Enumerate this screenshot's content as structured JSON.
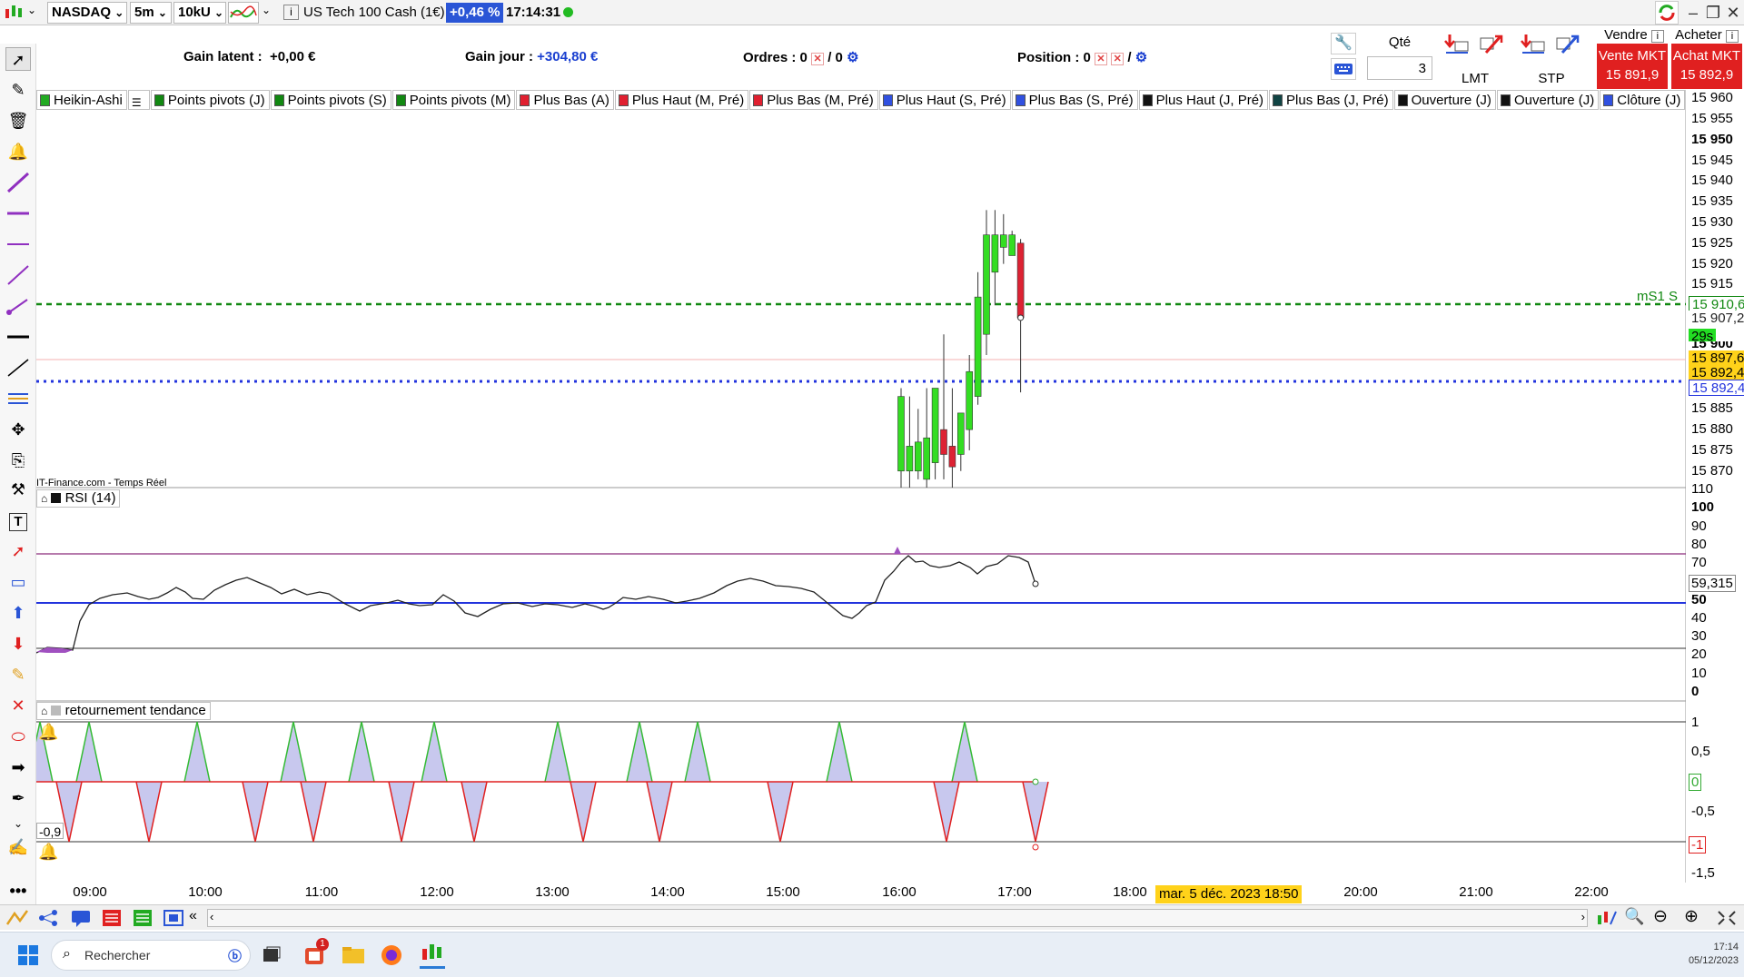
{
  "toolbar": {
    "market": "NASDAQ",
    "timeframe": "5m",
    "units": "10kU",
    "instrument": "US Tech 100 Cash (1€)",
    "change_pct": "+0,46 %",
    "time": "17:14:31"
  },
  "info": {
    "gain_latent_label": "Gain latent :",
    "gain_latent_value": "+0,00 €",
    "gain_jour_label": "Gain jour :",
    "gain_jour_value": "+304,80 €",
    "ordres_label": "Ordres :",
    "ordres_value": "0",
    "ordres_second": "/ 0",
    "position_label": "Position :",
    "position_value": "0",
    "position_sep": "/"
  },
  "order_panel": {
    "qty_label": "Qté",
    "qty_value": "3",
    "lmt_label": "LMT",
    "stp_label": "STP",
    "vendre_label": "Vendre",
    "acheter_label": "Acheter",
    "vente_mkt": "Vente MKT",
    "vente_price": "15 891,9",
    "achat_mkt": "Achat MKT",
    "achat_price": "15 892,9"
  },
  "legend": [
    {
      "label": "Heikin-Ashi",
      "color": "#22aa22"
    },
    {
      "label": "",
      "color": "#ffffff"
    },
    {
      "label": "Points pivots (J)",
      "color": "#118811"
    },
    {
      "label": "Points pivots (S)",
      "color": "#118811"
    },
    {
      "label": "Points pivots (M)",
      "color": "#118811"
    },
    {
      "label": "Plus Bas (A)",
      "color": "#e02030"
    },
    {
      "label": "Plus Haut (M, Pré)",
      "color": "#e02030"
    },
    {
      "label": "Plus Bas (M, Pré)",
      "color": "#e02030"
    },
    {
      "label": "Plus Haut (S, Pré)",
      "color": "#3050e0"
    },
    {
      "label": "Plus Bas (S, Pré)",
      "color": "#3050e0"
    },
    {
      "label": "Plus Haut (J, Pré)",
      "color": "#111111"
    },
    {
      "label": "Plus Bas (J, Pré)",
      "color": "#114444"
    },
    {
      "label": "Ouverture (J)",
      "color": "#111111"
    },
    {
      "label": "Ouverture (J)",
      "color": "#111111"
    },
    {
      "label": "Clôture (J)",
      "color": "#3050e0"
    }
  ],
  "price_axis": [
    "15 960",
    "15 955",
    "15 950",
    "15 945",
    "15 940",
    "15 935",
    "15 930",
    "15 925",
    "15 920",
    "15 915",
    "15 885",
    "15 880",
    "15 875",
    "15 870"
  ],
  "price_labels": {
    "ms1": "mS1 S",
    "ms1_value": "15 910,6",
    "last": "15 907,2",
    "timer": "29s",
    "partial": "15 900",
    "ask": "15 897,6",
    "bid": "15 892,4",
    "close_line": "15 892,4",
    "source": "IT-Finance.com - Temps Réel"
  },
  "rsi": {
    "title": "RSI (14)",
    "axis": [
      "110",
      "100",
      "90",
      "80",
      "70",
      "59,315",
      "50",
      "40",
      "30",
      "20",
      "10",
      "0"
    ]
  },
  "trend": {
    "title": "retournement tendance",
    "axis": [
      "1",
      "0,5",
      "0",
      "-0,5",
      "-1",
      "-1,5"
    ],
    "left_value": "-0,9"
  },
  "time_axis": [
    "09:00",
    "10:00",
    "11:00",
    "12:00",
    "13:00",
    "14:00",
    "15:00",
    "16:00",
    "17:00",
    "18:00",
    "20:00",
    "21:00",
    "22:00"
  ],
  "crosshair_date": "mar. 5 déc. 2023 18:50",
  "taskbar": {
    "search_placeholder": "Rechercher",
    "clock_time": "17:14",
    "clock_date": "05/12/2023",
    "notif_count": "1"
  },
  "colors": {
    "up": "#33dd22",
    "down": "#dd2233",
    "pivot": "#118811",
    "close_line": "#2233dd",
    "change_badge": "#2a55d6"
  },
  "chart_data": {
    "type": "candlestick",
    "ohlc": [
      {
        "o": 15870,
        "h": 15890,
        "l": 15866,
        "c": 15888
      },
      {
        "o": 15870,
        "h": 15888,
        "l": 15866,
        "c": 15876
      },
      {
        "o": 15870,
        "h": 15885,
        "l": 15868,
        "c": 15877
      },
      {
        "o": 15868,
        "h": 15890,
        "l": 15866,
        "c": 15878
      },
      {
        "o": 15872,
        "h": 15882,
        "l": 15868,
        "c": 15890
      },
      {
        "o": 15880,
        "h": 15903,
        "l": 15868,
        "c": 15874
      },
      {
        "o": 15876,
        "h": 15890,
        "l": 15866,
        "c": 15871
      },
      {
        "o": 15874,
        "h": 15882,
        "l": 15870,
        "c": 15884
      },
      {
        "o": 15880,
        "h": 15898,
        "l": 15875,
        "c": 15894
      },
      {
        "o": 15888,
        "h": 15918,
        "l": 15886,
        "c": 15912
      },
      {
        "o": 15903,
        "h": 15933,
        "l": 15898,
        "c": 15927
      },
      {
        "o": 15918,
        "h": 15933,
        "l": 15910,
        "c": 15927
      },
      {
        "o": 15924,
        "h": 15932,
        "l": 15920,
        "c": 15927
      },
      {
        "o": 15922,
        "h": 15928,
        "l": 15922,
        "c": 15927
      },
      {
        "o": 15925,
        "h": 15926,
        "l": 15889,
        "c": 15907
      }
    ],
    "ylim": [
      15866,
      15962
    ],
    "rsi_ylim": [
      0,
      110
    ],
    "rsi_levels": [
      70,
      50,
      25
    ],
    "rsi_last": 59.315,
    "trend_ylim": [
      -1.5,
      1
    ],
    "trend_last": 0
  }
}
